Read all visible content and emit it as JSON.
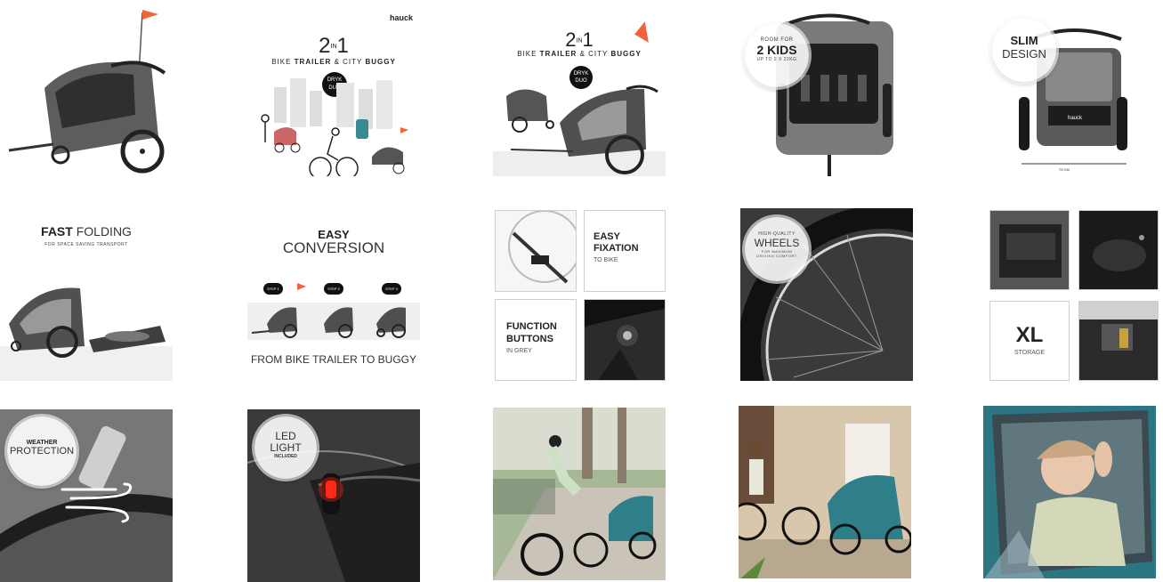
{
  "brand": {
    "logo": "hauck"
  },
  "row1": {
    "t2": {
      "title_2": "2",
      "title_in": "IN",
      "title_1": "1",
      "subtitle_a": "BIKE",
      "subtitle_b": "TRAILER",
      "subtitle_amp": "&",
      "subtitle_c": "CITY",
      "subtitle_d": "BUGGY",
      "badge_a": "DRYK",
      "badge_b": "DUO"
    },
    "t3": {
      "title_2": "2",
      "title_in": "IN",
      "title_1": "1",
      "subtitle_a": "BIKE",
      "subtitle_b": "TRAILER",
      "subtitle_amp": "&",
      "subtitle_c": "CITY",
      "subtitle_d": "BUGGY",
      "badge_a": "DRYK",
      "badge_b": "DUO"
    },
    "t4": {
      "room": "ROOM FOR",
      "kids": "2 KIDS",
      "weight": "UP TO 2 X 22KG"
    },
    "t5": {
      "slim": "SLIM",
      "design": "DESIGN",
      "dimension": "79 CM"
    }
  },
  "row2": {
    "t1": {
      "fast": "FAST",
      "folding": "FOLDING",
      "sub": "FOR SPACE SAVING TRANSPORT"
    },
    "t2": {
      "easy": "EASY",
      "conversion": "CONVERSION",
      "step1": "STEP 1",
      "step2": "STEP 2",
      "step3": "STEP 3",
      "caption": "FROM BIKE TRAILER TO BUGGY"
    },
    "t3": {
      "easy": "EASY",
      "fixation": "FIXATION",
      "to_bike": "TO BIKE",
      "function": "FUNCTION",
      "buttons": "BUTTONS",
      "in_grey": "IN GREY"
    },
    "t4": {
      "hq": "HIGH-QUALITY",
      "wheels": "WHEELS",
      "sub1": "FOR MAXIMUM",
      "sub2": "DRIVING COMFORT"
    },
    "t5": {
      "xl": "XL",
      "storage": "STORAGE"
    }
  },
  "row3": {
    "t1": {
      "weather": "WEATHER",
      "protection": "PROTECTION"
    },
    "t2": {
      "led": "LED",
      "light": "LIGHT",
      "included": "INCLUDED"
    }
  },
  "colors": {
    "flag": "#f0643c",
    "frame": "#4a4a4a",
    "teal": "#2f7f8a",
    "grey_fabric": "#6b6b6b"
  }
}
